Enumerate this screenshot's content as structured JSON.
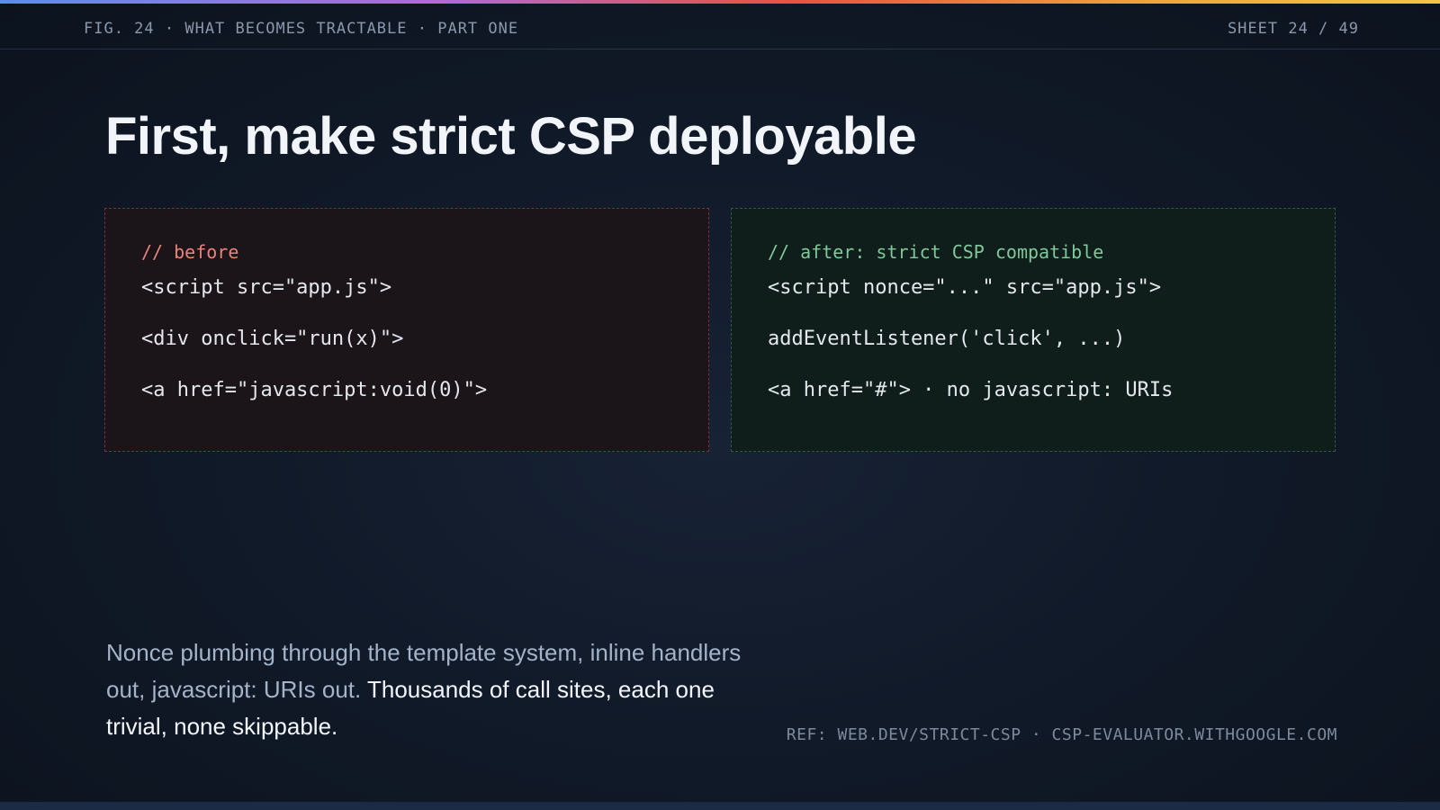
{
  "header": {
    "fig_label": "FIG. 24 · WHAT BECOMES TRACTABLE · PART ONE",
    "sheet_label": "SHEET 24 / 49"
  },
  "title": "First, make strict CSP deployable",
  "panels": {
    "before": {
      "comment": "// before",
      "lines": [
        "<script src=\"app.js\">",
        "<div onclick=\"run(x)\">",
        "<a href=\"javascript:void(0)\">"
      ]
    },
    "after": {
      "comment": "// after: strict CSP compatible",
      "lines": [
        "<script nonce=\"...\" src=\"app.js\">",
        "addEventListener('click', ...)",
        "<a href=\"#\"> · no javascript: URIs"
      ]
    }
  },
  "body": {
    "muted": "Nonce plumbing through the template system, inline handlers out, javascript: URIs out.",
    "strong": "Thousands of call sites, each one trivial, none skippable."
  },
  "reference": "REF: WEB.DEV/STRICT-CSP · CSP-EVALUATOR.WITHGOOGLE.COM",
  "colors": {
    "before_accent": "#e9837a",
    "after_accent": "#7fc99a",
    "background": "#111a29"
  }
}
